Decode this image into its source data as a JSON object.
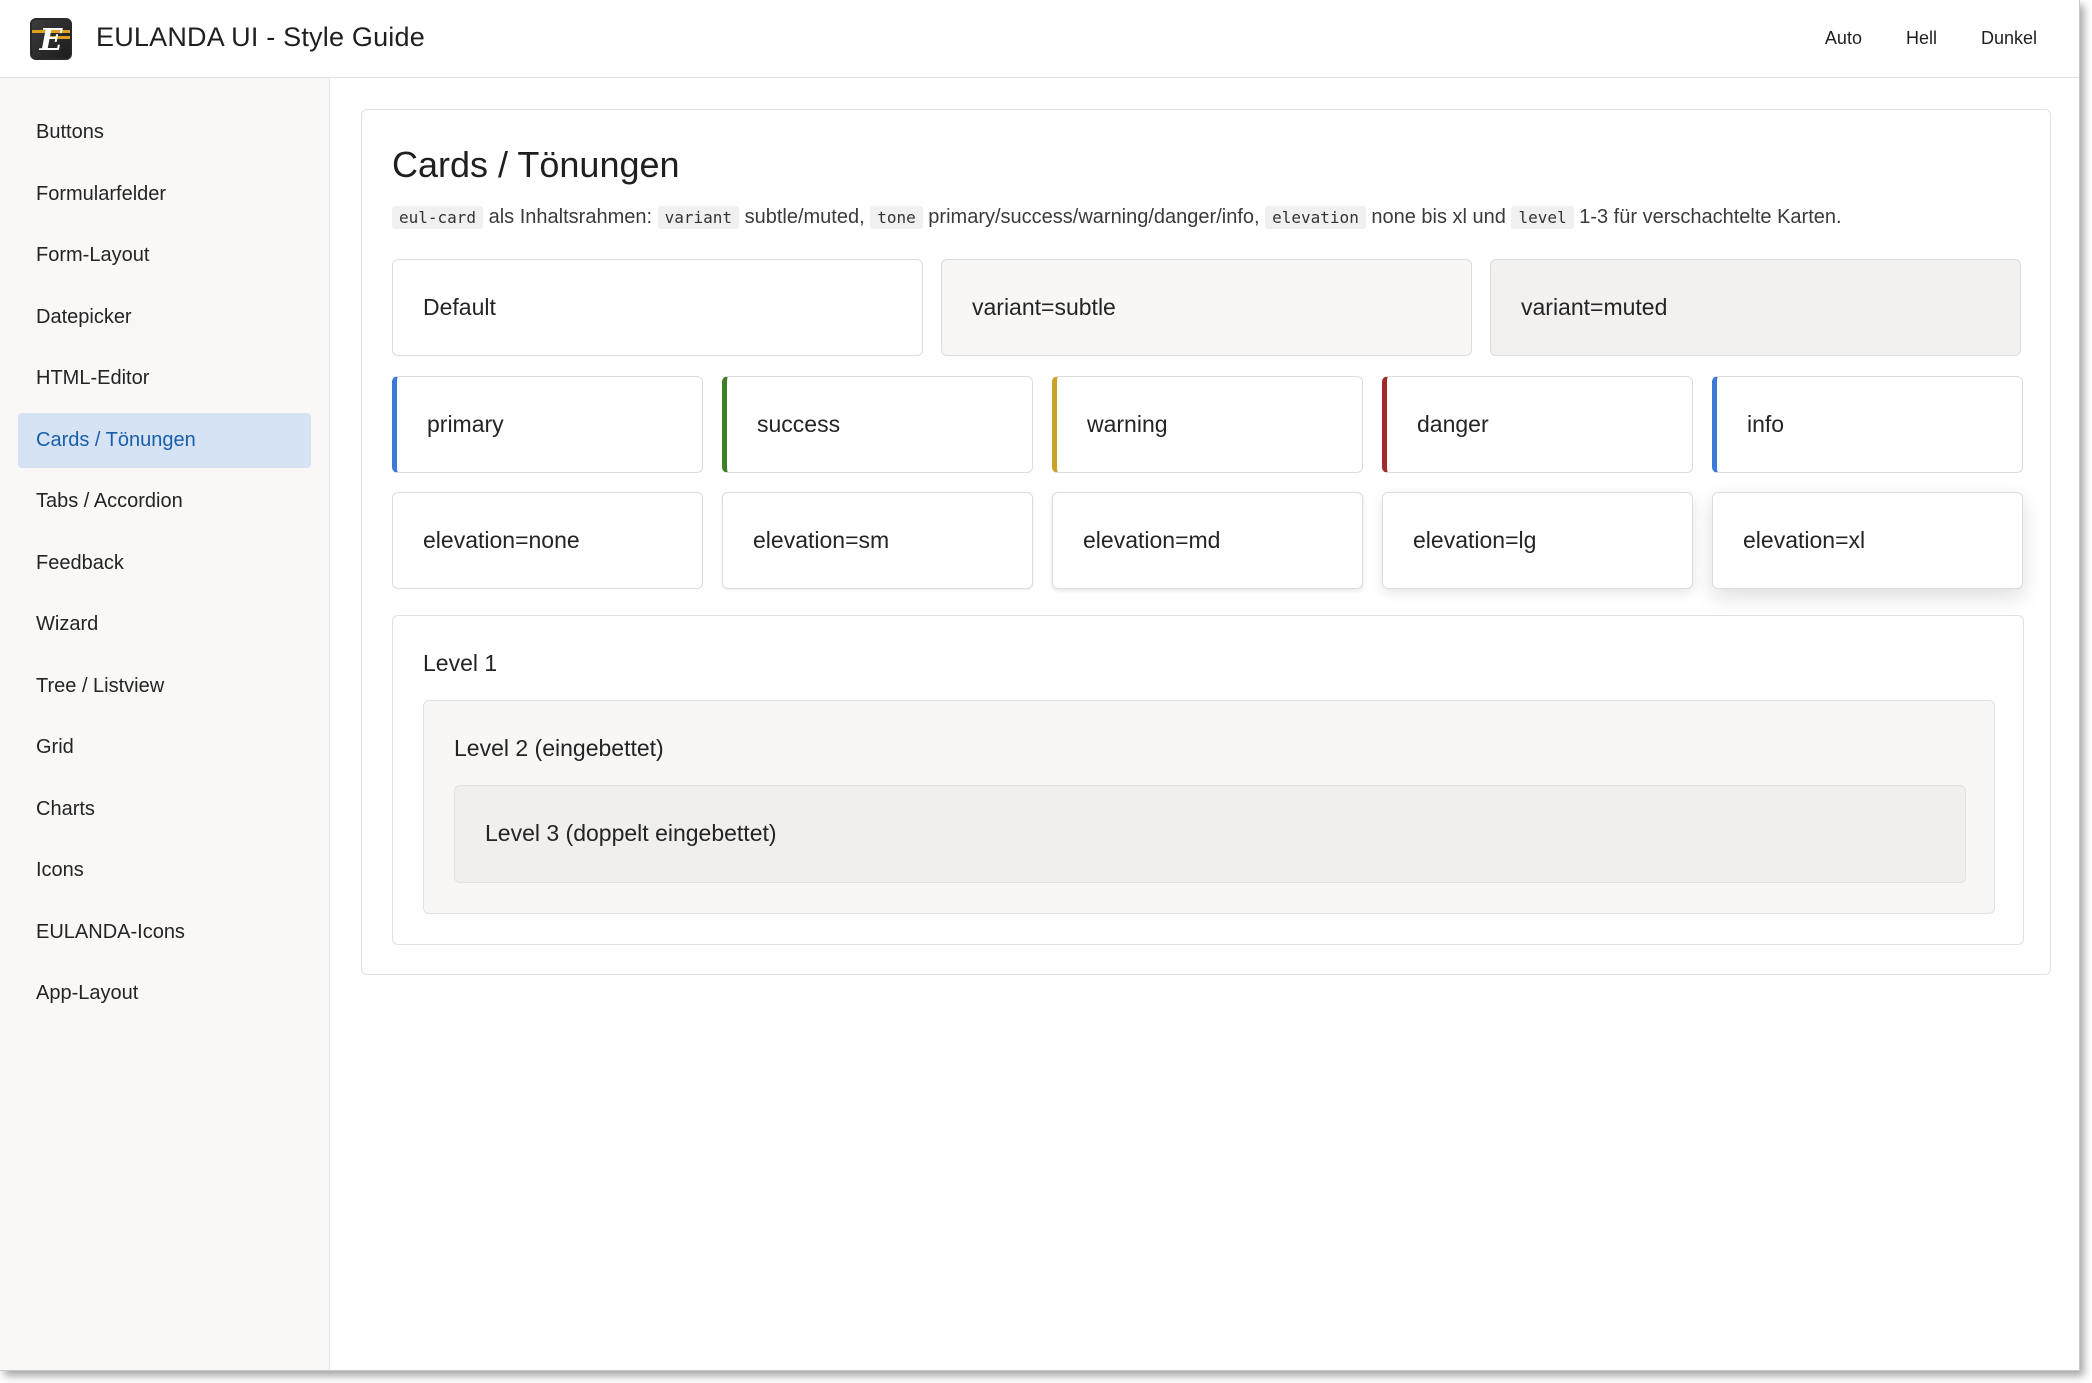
{
  "app": {
    "title": "EULANDA UI - Style Guide",
    "logo_letter": "E"
  },
  "theme_switch": [
    "Auto",
    "Hell",
    "Dunkel"
  ],
  "sidebar": {
    "items": [
      {
        "label": "Buttons",
        "active": false
      },
      {
        "label": "Formularfelder",
        "active": false
      },
      {
        "label": "Form-Layout",
        "active": false
      },
      {
        "label": "Datepicker",
        "active": false
      },
      {
        "label": "HTML-Editor",
        "active": false
      },
      {
        "label": "Cards / Tönungen",
        "active": true
      },
      {
        "label": "Tabs / Accordion",
        "active": false
      },
      {
        "label": "Feedback",
        "active": false
      },
      {
        "label": "Wizard",
        "active": false
      },
      {
        "label": "Tree / Listview",
        "active": false
      },
      {
        "label": "Grid",
        "active": false
      },
      {
        "label": "Charts",
        "active": false
      },
      {
        "label": "Icons",
        "active": false
      },
      {
        "label": "EULANDA-Icons",
        "active": false
      },
      {
        "label": "App-Layout",
        "active": false
      }
    ]
  },
  "section": {
    "title": "Cards / Tönungen",
    "description": {
      "code1": "eul-card",
      "text1": " als Inhaltsrahmen: ",
      "code2": "variant",
      "text2": " subtle/muted, ",
      "code3": "tone",
      "text3": " primary/success/warning/danger/info, ",
      "code4": "elevation",
      "text4": " none bis xl und ",
      "code5": "level",
      "text5": " 1-3 für verschachtelte Karten."
    },
    "variant_cards": [
      "Default",
      "variant=subtle",
      "variant=muted"
    ],
    "tone_cards": [
      {
        "label": "primary",
        "color": "#3b78d8"
      },
      {
        "label": "success",
        "color": "#3f7f2a"
      },
      {
        "label": "warning",
        "color": "#c9a227"
      },
      {
        "label": "danger",
        "color": "#a12a2a"
      },
      {
        "label": "info",
        "color": "#3b78d8"
      }
    ],
    "elevation_cards": [
      {
        "label": "elevation=none",
        "shadow": "none"
      },
      {
        "label": "elevation=sm",
        "shadow": "sm"
      },
      {
        "label": "elevation=md",
        "shadow": "md"
      },
      {
        "label": "elevation=lg",
        "shadow": "lg"
      },
      {
        "label": "elevation=xl",
        "shadow": "xl"
      }
    ],
    "levels": {
      "level1": "Level 1",
      "level2": "Level 2 (eingebettet)",
      "level3": "Level 3 (doppelt eingebettet)"
    }
  }
}
